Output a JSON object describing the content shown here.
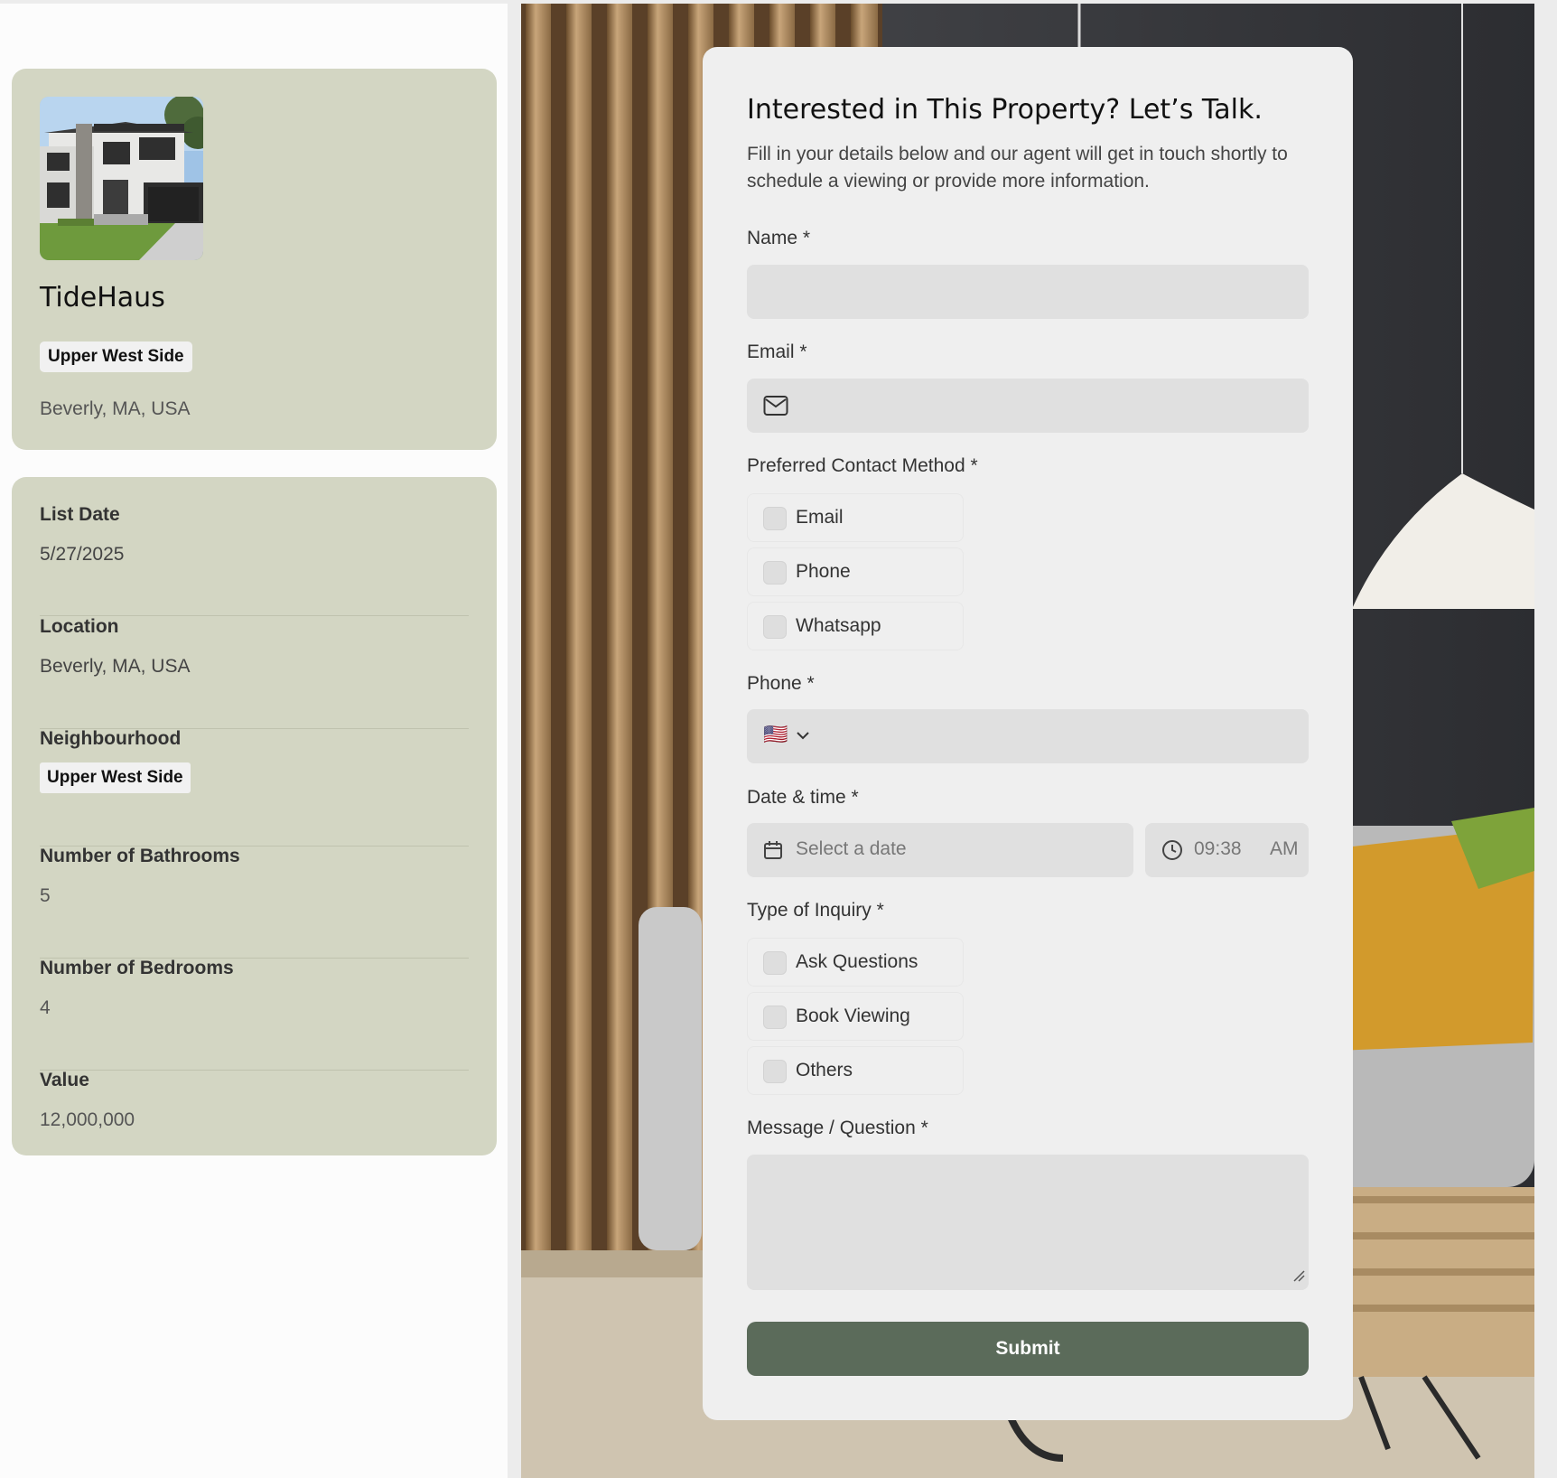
{
  "property": {
    "name": "TideHaus",
    "neighbourhood_chip": "Upper West Side",
    "location": "Beverly, MA, USA"
  },
  "details": [
    {
      "label": "List Date",
      "value": "5/27/2025"
    },
    {
      "label": "Location",
      "value": "Beverly, MA, USA"
    },
    {
      "label": "Neighbourhood",
      "value": "Upper West Side"
    },
    {
      "label": "Number of Bathrooms",
      "value": "5"
    },
    {
      "label": "Number of Bedrooms",
      "value": "4"
    },
    {
      "label": "Value",
      "value": "12,000,000"
    }
  ],
  "form": {
    "title": "Interested in This Property? Let’s Talk.",
    "subtitle": "Fill in your details below and our agent will get in touch shortly to schedule a viewing or provide more information.",
    "name_label": "Name *",
    "email_label": "Email *",
    "contact_label": "Preferred Contact Method *",
    "contact_options": [
      "Email",
      "Phone",
      "Whatsapp"
    ],
    "phone_label": "Phone *",
    "phone_flag": "🇺🇸",
    "datetime_label": "Date & time *",
    "date_placeholder": "Select a date",
    "time_value": "09:38",
    "time_period": "AM",
    "inquiry_label": "Type of Inquiry *",
    "inquiry_options": [
      "Ask Questions",
      "Book Viewing",
      "Others"
    ],
    "message_label": "Message / Question *",
    "submit_label": "Submit"
  },
  "colors": {
    "card_bg": "#d3d6c3",
    "submit_bg": "#5b6b5a",
    "panel_bg": "#efefef",
    "field_bg": "#e0e0e0"
  }
}
